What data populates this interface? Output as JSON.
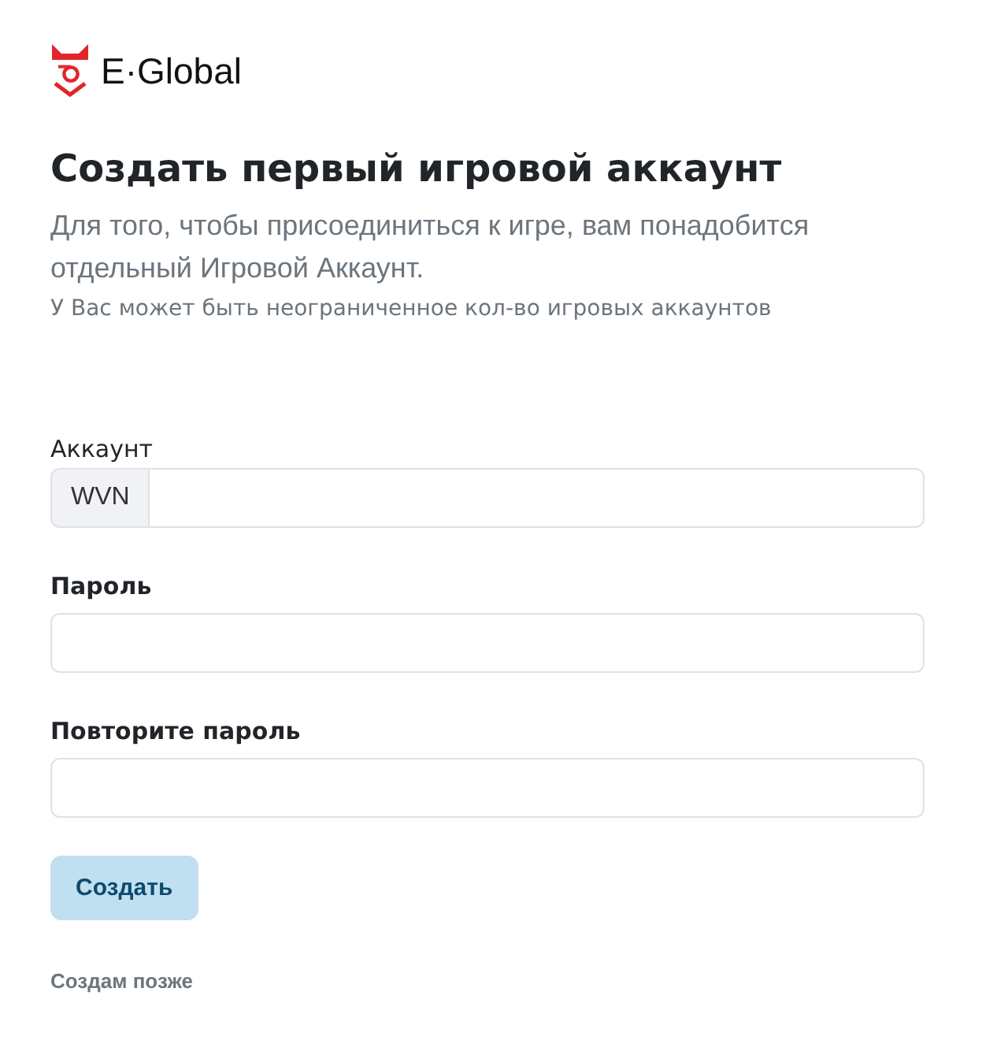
{
  "logo": {
    "text": "E·Global"
  },
  "heading": "Создать первый игровой аккаунт",
  "description": "Для того, чтобы присоединиться к игре, вам понадобится отдельный Игровой Аккаунт.",
  "note": "У Вас может быть неограниченное кол-во игровых аккаунтов",
  "fields": [
    {
      "kind": "prefixed",
      "label": "Аккаунт",
      "prefix": "WVN"
    },
    {
      "kind": "password",
      "label": "Пароль"
    },
    {
      "kind": "password",
      "label": "Повторите пароль"
    }
  ],
  "submit_button": {
    "label": "Создать"
  },
  "later_link": {
    "label": "Создам позже"
  }
}
